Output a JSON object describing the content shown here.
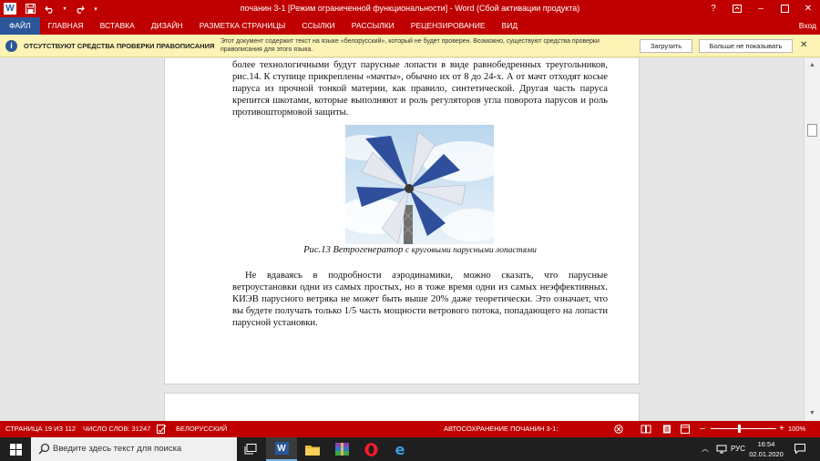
{
  "titlebar": {
    "title": "почанин 3-1 [Режим ограниченной функциональности]  -  Word (Сбой активации продукта)",
    "help": "?",
    "minimize": "–",
    "close": "✕"
  },
  "ribbon": {
    "tabs": [
      "ФАЙЛ",
      "ГЛАВНАЯ",
      "ВСТАВКА",
      "ДИЗАЙН",
      "РАЗМЕТКА СТРАНИЦЫ",
      "ССЫЛКИ",
      "РАССЫЛКИ",
      "РЕЦЕНЗИРОВАНИЕ",
      "ВИД"
    ],
    "login": "Вход"
  },
  "message_bar": {
    "heading": "ОТСУТСТВУЮТ СРЕДСТВА ПРОВЕРКИ ПРАВОПИСАНИЯ",
    "text": "Этот документ содержит текст на языке «белорусский», который не будет проверен. Возможно, существуют средства проверки правописания для этого языка.",
    "load_label": "Загрузить",
    "dismiss_label": "Больше не показывать"
  },
  "document": {
    "paragraph1": "более технологичными будут парусные лопасти в виде равнобедренных треугольников, рис.14. К ступице прикреплены «мачты», обычно их от 8 до 24-х. А от мачт отходят косые паруса из прочной тонкой материи, как правило, синтетической. Другая часть паруса крепится шкотами, которые выполняют и роль регуляторов угла поворота парусов и роль противоштормовой защиты.",
    "caption_main": "Рис.13 Ветрогенератор",
    "caption_rest": "с круговыми парусными лопастями",
    "paragraph2": "Не вдаваясь в подробности аэродинамики, можно сказать, что парусные ветроустановки  одни из самых простых, но в тоже время одни из самых неэффективных. КИЭВ парусного ветряка не может быть выше 20% даже теоретически. Это означает, что вы будете получать только 1/5 часть мощности ветрового потока, попадающего на лопасти парусной установки."
  },
  "statusbar": {
    "page": "СТРАНИЦА 19 ИЗ 112",
    "words": "ЧИСЛО СЛОВ: 31247",
    "language": "БЕЛОРУССКИЙ",
    "autosave": "АВТОСОХРАНЕНИЕ ПОЧАНИН 3-1:",
    "zoom_minus": "–",
    "zoom_plus": "+",
    "zoom": "100%"
  },
  "taskbar": {
    "search_placeholder": "Введите здесь текст для поиска",
    "language": "РУС",
    "time": "16:54",
    "date": "02.01.2020"
  },
  "colors": {
    "accent": "#c00000",
    "file_tab": "#2b579a",
    "message_bar": "#fcf3b4",
    "taskbar": "#1f1f1f"
  }
}
